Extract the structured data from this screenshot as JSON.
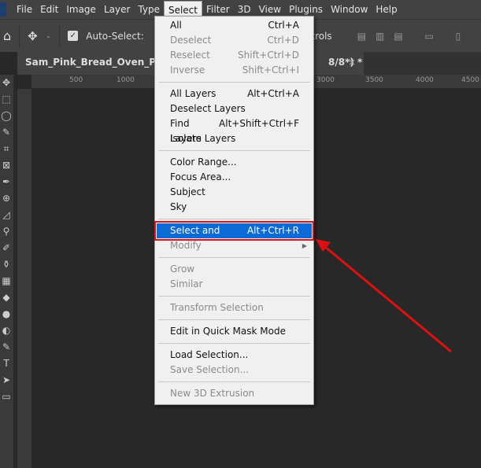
{
  "menubar": [
    "File",
    "Edit",
    "Image",
    "Layer",
    "Type",
    "Select",
    "Filter",
    "3D",
    "View",
    "Plugins",
    "Window",
    "Help"
  ],
  "options": {
    "auto_select": "Auto-Select:",
    "controls_partial": "ntrols"
  },
  "tab": {
    "title": "Sam_Pink_Bread_Oven_PRI",
    "tail": "8/8*) *",
    "close": "×"
  },
  "ruler": [
    "500",
    "1000",
    "3000",
    "3500",
    "4000",
    "4500"
  ],
  "menu": [
    {
      "label": "All",
      "shortcut": "Ctrl+A",
      "enabled": true
    },
    {
      "label": "Deselect",
      "shortcut": "Ctrl+D",
      "enabled": false
    },
    {
      "label": "Reselect",
      "shortcut": "Shift+Ctrl+D",
      "enabled": false
    },
    {
      "label": "Inverse",
      "shortcut": "Shift+Ctrl+I",
      "enabled": false
    },
    {
      "sep": true
    },
    {
      "label": "All Layers",
      "shortcut": "Alt+Ctrl+A",
      "enabled": true
    },
    {
      "label": "Deselect Layers",
      "shortcut": "",
      "enabled": true
    },
    {
      "label": "Find Layers",
      "shortcut": "Alt+Shift+Ctrl+F",
      "enabled": true
    },
    {
      "label": "Isolate Layers",
      "shortcut": "",
      "enabled": true
    },
    {
      "sep": true
    },
    {
      "label": "Color Range...",
      "shortcut": "",
      "enabled": true
    },
    {
      "label": "Focus Area...",
      "shortcut": "",
      "enabled": true
    },
    {
      "label": "Subject",
      "shortcut": "",
      "enabled": true
    },
    {
      "label": "Sky",
      "shortcut": "",
      "enabled": true
    },
    {
      "sep": true
    },
    {
      "label": "Select and Mask...",
      "shortcut": "Alt+Ctrl+R",
      "enabled": true,
      "highlight": true
    },
    {
      "label": "Modify",
      "shortcut": "",
      "enabled": false,
      "submenu": true
    },
    {
      "sep": true
    },
    {
      "label": "Grow",
      "shortcut": "",
      "enabled": false
    },
    {
      "label": "Similar",
      "shortcut": "",
      "enabled": false
    },
    {
      "sep": true
    },
    {
      "label": "Transform Selection",
      "shortcut": "",
      "enabled": false
    },
    {
      "sep": true
    },
    {
      "label": "Edit in Quick Mask Mode",
      "shortcut": "",
      "enabled": true
    },
    {
      "sep": true
    },
    {
      "label": "Load Selection...",
      "shortcut": "",
      "enabled": true
    },
    {
      "label": "Save Selection...",
      "shortcut": "",
      "enabled": false
    },
    {
      "sep": true
    },
    {
      "label": "New 3D Extrusion",
      "shortcut": "",
      "enabled": false
    }
  ],
  "colors": {
    "highlight": "#0a6ad6",
    "annotation": "#e01010"
  }
}
